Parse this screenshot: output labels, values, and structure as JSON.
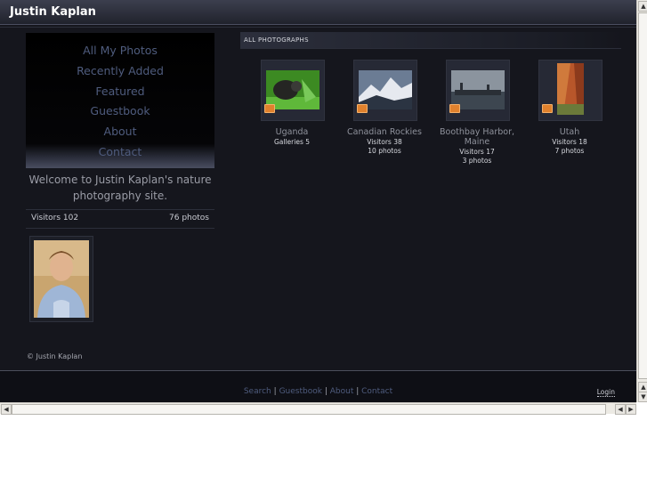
{
  "header": {
    "title": "Justin Kaplan"
  },
  "nav": [
    {
      "label": "All My Photos"
    },
    {
      "label": "Recently Added"
    },
    {
      "label": "Featured"
    },
    {
      "label": "Guestbook"
    },
    {
      "label": "About"
    },
    {
      "label": "Contact"
    }
  ],
  "sidebar": {
    "welcome": "Welcome to Justin Kaplan's nature photography site.",
    "visitors": "Visitors 102",
    "photos": "76 photos"
  },
  "section": {
    "title": "ALL PHOTOGRAPHS"
  },
  "albums": [
    {
      "name": "Uganda",
      "meta1": "Galleries 5",
      "meta2": ""
    },
    {
      "name": "Canadian Rockies",
      "meta1": "Visitors 38",
      "meta2": "10 photos"
    },
    {
      "name": "Boothbay Harbor, Maine",
      "meta1": "Visitors 17",
      "meta2": "3 photos"
    },
    {
      "name": "Utah",
      "meta1": "Visitors 18",
      "meta2": "7 photos"
    }
  ],
  "footer": {
    "copyright": "© Justin Kaplan",
    "links": [
      {
        "label": "Search"
      },
      {
        "label": "Guestbook"
      },
      {
        "label": "About"
      },
      {
        "label": "Contact"
      }
    ],
    "separator": "|",
    "login": "Login"
  },
  "colors": {
    "background": "#15161d",
    "link": "#4f5c7e",
    "badge": "#e0812d"
  }
}
